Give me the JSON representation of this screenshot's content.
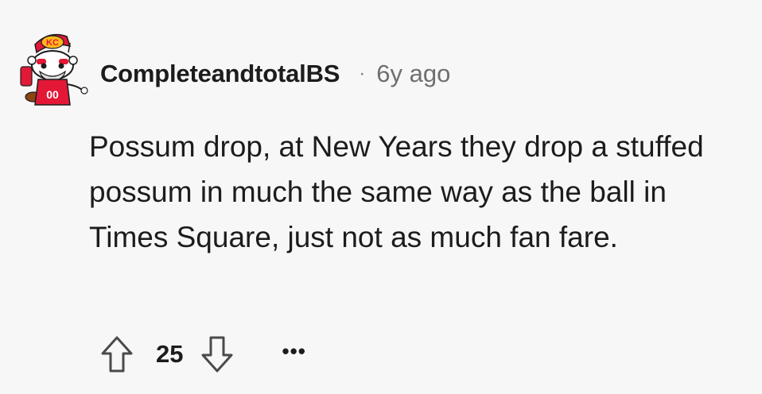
{
  "comment": {
    "author": "CompleteandtotalBS",
    "separator": "·",
    "age": "6y ago",
    "avatar_icon": "kansas-city-chiefs-snoo-avatar",
    "avatar_logo_text": "KC",
    "avatar_jersey_number": "00",
    "body": "Possum drop, at New Years they drop a stuffed possum in much the same way as the ball in Times Square, just not as much fan fare.",
    "score": "25",
    "upvote_icon": "arrow-up-outline-icon",
    "downvote_icon": "arrow-down-outline-icon",
    "more_label": "•••"
  },
  "colors": {
    "background": "#f7f7f7",
    "text": "#1c1c1c",
    "muted": "#6f6f6f",
    "chiefs_red": "#e31837",
    "chiefs_gold": "#ffb81c"
  }
}
